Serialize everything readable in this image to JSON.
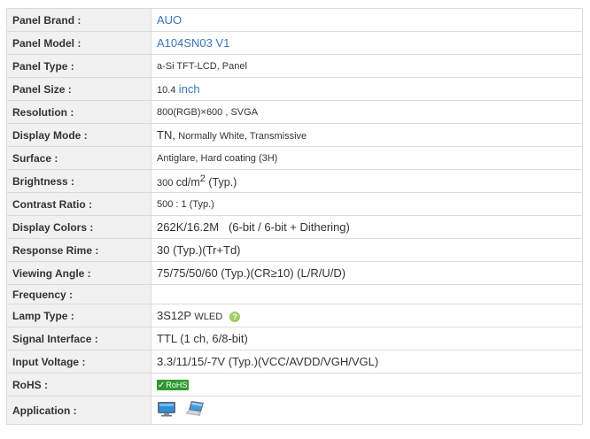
{
  "rows": [
    {
      "label": "Panel Brand :",
      "value": "AUO"
    },
    {
      "label": "Panel Model :",
      "value": "A104SN03 V1"
    },
    {
      "label": "Panel Type :",
      "value": "a-Si TFT-LCD, Panel"
    },
    {
      "label": "Panel Size :",
      "value_num": "10.4",
      "value_unit": "inch"
    },
    {
      "label": "Resolution :",
      "value": "800(RGB)×600 , SVGA"
    },
    {
      "label": "Display Mode :",
      "value_a": "TN,",
      "value_b": "Normally White, Transmissive"
    },
    {
      "label": "Surface :",
      "value": "Antiglare, Hard coating (3H)"
    },
    {
      "label": "Brightness :",
      "value_num": "300",
      "value_unit": "cd/m",
      "value_sup": "2",
      "value_suffix": " (Typ.)"
    },
    {
      "label": "Contrast Ratio :",
      "value": "500 : 1 (Typ.)"
    },
    {
      "label": "Display Colors :",
      "value": "262K/16.2M   (6-bit / 6-bit + Dithering)"
    },
    {
      "label": "Response Rime :",
      "value": "30 (Typ.)(Tr+Td)"
    },
    {
      "label": "Viewing Angle :",
      "value": "75/75/50/60 (Typ.)(CR≥10) (L/R/U/D)"
    },
    {
      "label": "Frequency :",
      "value": ""
    },
    {
      "label": "Lamp Type :",
      "value_a": "3S12P",
      "value_b": "WLED",
      "help_glyph": "?"
    },
    {
      "label": "Signal Interface :",
      "value": "TTL (1 ch, 6/8-bit)"
    },
    {
      "label": "Input Voltage :",
      "value": "3.3/11/15/-7V (Typ.)(VCC/AVDD/VGH/VGL)"
    },
    {
      "label": "RoHS :",
      "badge_check": "✓",
      "badge_text": "RoHS"
    },
    {
      "label": "Application :"
    }
  ],
  "colors": {
    "label_bg": "#f1f1f1",
    "border": "#dcdcdc",
    "link": "#3a76b8",
    "rohs_green": "#2e9b2e"
  },
  "icons": {
    "application": [
      "monitor-icon",
      "laptop-icon"
    ],
    "lamp_help": "help-icon"
  }
}
